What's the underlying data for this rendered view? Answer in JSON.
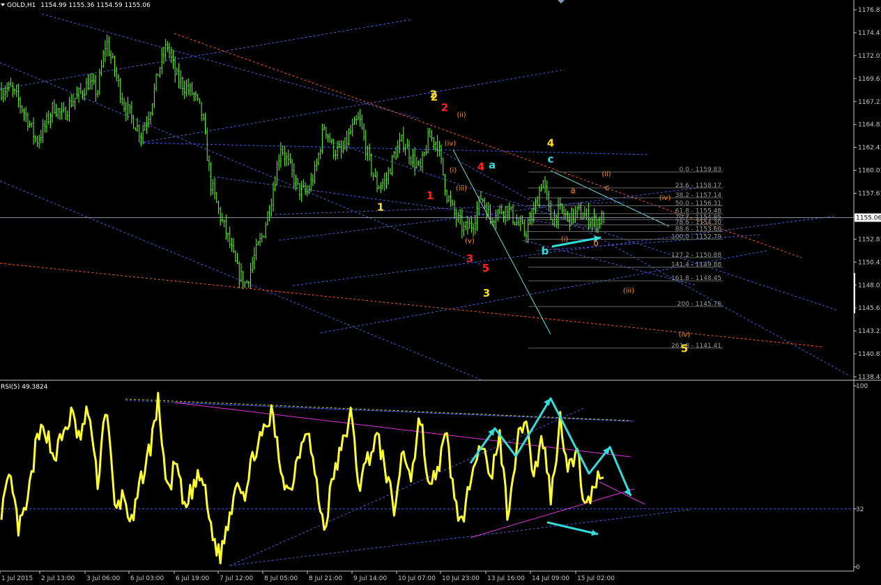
{
  "colors": {
    "background": "#000000",
    "candle": "#66ff33",
    "rsi_line": "#ffff33",
    "trend_blue": "#4a5fdc",
    "trend_red": "#ff5a1f",
    "trend_cyan": "#66dddd",
    "trend_magenta": "#dd33dd",
    "fib": "#666666",
    "arrow": "#33dddd",
    "wave_yellow": "#ffdd22",
    "wave_red": "#ff2222",
    "wave_cyan": "#33dddd",
    "wave_orange": "#ff8c1a"
  },
  "chart_data": [
    {
      "type": "line",
      "title": "GOLD,H1  1154.99 1155.36 1154.59 1155.06",
      "symbol": "GOLD,H1",
      "ohlc_text": "1154.99 1155.36 1154.59 1155.06",
      "current_price": 1155.06,
      "current_price_label": "1155.06",
      "ylim": [
        1138.41,
        1176.81
      ],
      "y_ticks": [
        1176.81,
        1174.41,
        1172.01,
        1169.61,
        1167.21,
        1164.81,
        1162.41,
        1160.01,
        1157.61,
        1155.21,
        1152.81,
        1150.41,
        1148.01,
        1145.61,
        1143.21,
        1140.81,
        1138.41
      ],
      "y_tick_labels": [
        "1176.81",
        "1174.41",
        "1172.01",
        "1169.61",
        "1167.21",
        "1164.81",
        "1162.41",
        "1160.01",
        "1157.61",
        "",
        "1152.81",
        "1150.41",
        "1148.01",
        "1145.61",
        "1143.21",
        "1140.81",
        "1138.41"
      ],
      "close_path": [
        1168.4,
        1168.6,
        1167.2,
        1165.4,
        1163.0,
        1164.6,
        1166.8,
        1165.6,
        1167.2,
        1168.0,
        1169.2,
        1168.2,
        1173.6,
        1170.4,
        1167.0,
        1165.4,
        1163.8,
        1166.2,
        1170.4,
        1173.2,
        1169.8,
        1168.8,
        1168.0,
        1165.8,
        1158.6,
        1155.4,
        1152.8,
        1149.6,
        1148.0,
        1151.0,
        1153.4,
        1157.4,
        1162.6,
        1160.4,
        1158.0,
        1157.6,
        1160.0,
        1164.8,
        1162.2,
        1161.8,
        1164.0,
        1165.4,
        1161.4,
        1158.4,
        1158.8,
        1161.6,
        1163.2,
        1161.4,
        1160.0,
        1163.6,
        1162.8,
        1157.6,
        1155.2,
        1153.8,
        1154.4,
        1157.4,
        1155.0,
        1155.8,
        1156.0,
        1154.6,
        1153.4,
        1155.6,
        1159.2,
        1154.8,
        1155.8,
        1155.0,
        1155.6,
        1155.2,
        1154.6,
        1155.06
      ],
      "wave_labels": [
        {
          "text": "2",
          "color": "wave_yellow",
          "x": "1 Jul 2015",
          "y": 1167.6
        },
        {
          "text": "1",
          "color": "wave_yellow",
          "x": "9 Jul 2015",
          "y": 1155.8
        },
        {
          "text": "2",
          "color": "wave_yellow",
          "x": "10 Jul 2015",
          "y": 1167.3
        },
        {
          "text": "3",
          "color": "wave_yellow",
          "x": "13 Jul 2015",
          "y": 1146.8
        },
        {
          "text": "4",
          "color": "wave_yellow",
          "x": "14 Jul 2015",
          "y": 1162.5
        },
        {
          "text": "5",
          "color": "wave_yellow",
          "x": "16 Jul 2015",
          "y": 1141.0
        },
        {
          "text": "2",
          "color": "wave_red",
          "x": "10 Jul 2015",
          "y": 1166.2
        },
        {
          "text": "1",
          "color": "wave_red",
          "x": "10 Jul 2015",
          "y": 1157.0
        },
        {
          "text": "4",
          "color": "wave_red",
          "x": "13 Jul 2015",
          "y": 1160.0
        },
        {
          "text": "3",
          "color": "wave_red",
          "x": "13 Jul 2015",
          "y": 1150.4
        },
        {
          "text": "5",
          "color": "wave_red",
          "x": "13 Jul 2015",
          "y": 1149.4
        },
        {
          "text": "a",
          "color": "wave_cyan",
          "x": "13 Jul 2015",
          "y": 1160.2
        },
        {
          "text": "c",
          "color": "wave_cyan",
          "x": "14 Jul 2015",
          "y": 1160.8
        },
        {
          "text": "b",
          "color": "wave_cyan",
          "x": "14 Jul 2015",
          "y": 1151.2
        },
        {
          "text": "(ii)",
          "color": "wave_orange",
          "x": "10 Jul 2015",
          "y": 1165.6
        },
        {
          "text": "(iv)",
          "color": "wave_orange",
          "x": "10 Jul 2015",
          "y": 1162.6
        },
        {
          "text": "(i)",
          "color": "wave_orange",
          "x": "10 Jul 2015",
          "y": 1159.8
        },
        {
          "text": "(iii)",
          "color": "wave_orange",
          "x": "10 Jul 2015",
          "y": 1157.9
        },
        {
          "text": "(v)",
          "color": "wave_orange",
          "x": "13 Jul 2015",
          "y": 1152.4
        },
        {
          "text": "(ii)",
          "color": "wave_orange",
          "x": "15 Jul 2015",
          "y": 1159.4
        },
        {
          "text": "a",
          "color": "wave_orange",
          "x": "15 Jul 2015",
          "y": 1157.6
        },
        {
          "text": "c",
          "color": "wave_orange",
          "x": "15 Jul 2015",
          "y": 1157.9
        },
        {
          "text": "(iv)",
          "color": "wave_orange",
          "x": "15 Jul 2015",
          "y": 1156.9
        },
        {
          "text": "(i)",
          "color": "wave_orange",
          "x": "14 Jul 2015",
          "y": 1152.6
        },
        {
          "text": "b",
          "color": "wave_orange",
          "x": "15 Jul 2015",
          "y": 1152.1
        },
        {
          "text": "(iii)",
          "color": "wave_orange",
          "x": "16 Jul 2015",
          "y": 1147.2
        },
        {
          "text": "(iv)",
          "color": "wave_orange",
          "x": "16 Jul 2015",
          "y": 1142.6
        }
      ],
      "fib_levels": [
        {
          "label": "0.0 - 1159.83",
          "value": 1159.83
        },
        {
          "label": "23.6 - 1158.17",
          "value": 1158.17
        },
        {
          "label": "38.2 - 1157.14",
          "value": 1157.14
        },
        {
          "label": "50.0 - 1156.31",
          "value": 1156.31
        },
        {
          "label": "61.8 - 1155.48",
          "value": 1155.48
        },
        {
          "label": "70.7 - 1154.85",
          "value": 1154.85
        },
        {
          "label": "78.6 - 1154.30",
          "value": 1154.3
        },
        {
          "label": "88.6 - 1153.60",
          "value": 1153.6
        },
        {
          "label": "100.0 - 1152.79",
          "value": 1152.79
        },
        {
          "label": "127.2 - 1150.88",
          "value": 1150.88
        },
        {
          "label": "141.4 - 1149.88",
          "value": 1149.88
        },
        {
          "label": "161.8 - 1148.45",
          "value": 1148.45
        },
        {
          "label": "200 - 1145.76",
          "value": 1145.76
        },
        {
          "label": "261.8 - 1141.41",
          "value": 1141.41
        }
      ]
    },
    {
      "type": "line",
      "title": "RSI(5) 49.3824",
      "indicator": "RSI(5)",
      "current_value": 49.3824,
      "current_value_text": "49.3824",
      "ylim": [
        0,
        100
      ],
      "y_ticks": [
        100,
        32,
        0
      ],
      "y_tick_labels": [
        "100",
        "32",
        "0"
      ],
      "reference_level": 32,
      "values_path": [
        32,
        48,
        20,
        35,
        68,
        78,
        60,
        72,
        84,
        70,
        88,
        45,
        93,
        30,
        40,
        22,
        48,
        65,
        92,
        40,
        58,
        30,
        45,
        50,
        22,
        5,
        25,
        50,
        40,
        65,
        72,
        85,
        55,
        40,
        62,
        80,
        48,
        20,
        50,
        65,
        85,
        45,
        60,
        72,
        55,
        30,
        65,
        50,
        85,
        40,
        55,
        72,
        35,
        22,
        60,
        70,
        45,
        75,
        30,
        65,
        85,
        50,
        72,
        38,
        82,
        55,
        62,
        30,
        48,
        49.38
      ],
      "x_labels": [
        "1 Jul 2015",
        "2 Jul 13:00",
        "3 Jul 06:00",
        "6 Jul 03:00",
        "6 Jul 19:00",
        "7 Jul 12:00",
        "8 Jul 05:00",
        "8 Jul 21:00",
        "9 Jul 14:00",
        "10 Jul 07:00",
        "10 Jul 23:00",
        "13 Jul 16:00",
        "14 Jul 09:00",
        "15 Jul 02:00"
      ]
    }
  ]
}
